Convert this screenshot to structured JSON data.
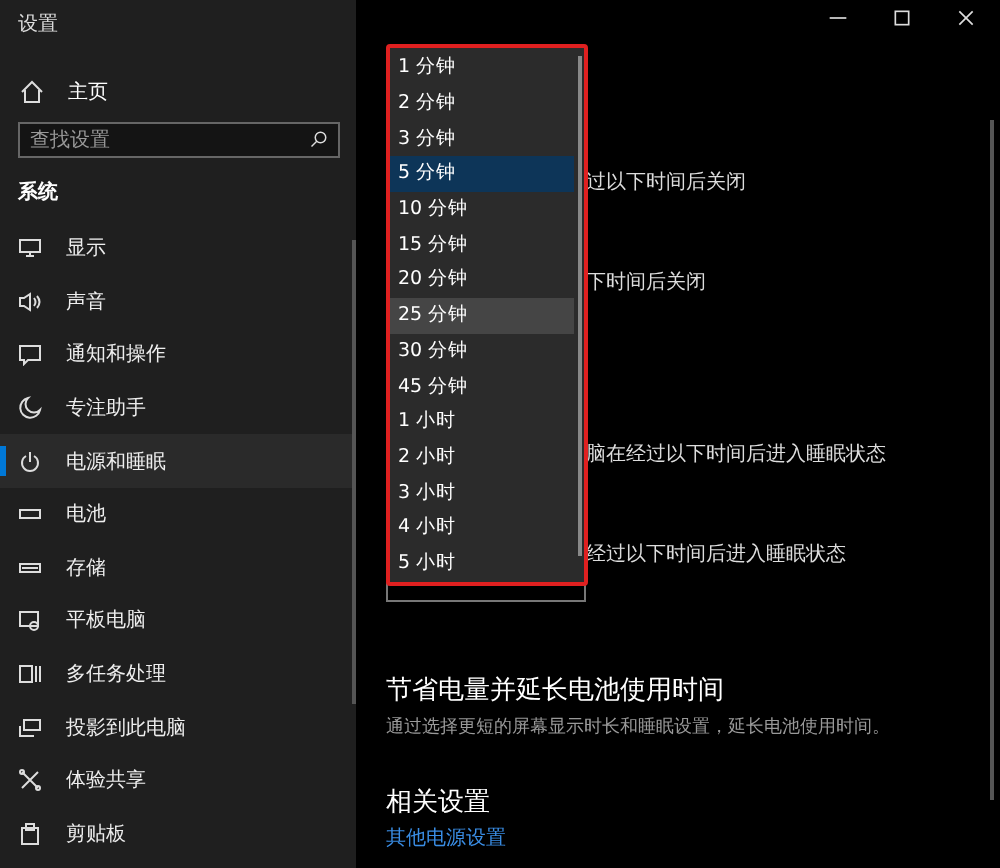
{
  "window": {
    "title": "设置"
  },
  "sidebar": {
    "home": "主页",
    "search": {
      "placeholder": "查找设置"
    },
    "section": "系统",
    "items": [
      {
        "label": "显示",
        "selected": false
      },
      {
        "label": "声音",
        "selected": false
      },
      {
        "label": "通知和操作",
        "selected": false
      },
      {
        "label": "专注助手",
        "selected": false
      },
      {
        "label": "电源和睡眠",
        "selected": true
      },
      {
        "label": "电池",
        "selected": false
      },
      {
        "label": "存储",
        "selected": false
      },
      {
        "label": "平板电脑",
        "selected": false
      },
      {
        "label": "多任务处理",
        "selected": false
      },
      {
        "label": "投影到此电脑",
        "selected": false
      },
      {
        "label": "体验共享",
        "selected": false
      },
      {
        "label": "剪贴板",
        "selected": false
      }
    ]
  },
  "content": {
    "setting_texts": [
      "过以下时间后关闭",
      "下时间后关闭",
      "脑在经过以下时间后进入睡眠状态",
      "经过以下时间后进入睡眠状态"
    ],
    "section_title": "节省电量并延长电池使用时间",
    "section_description": "通过选择更短的屏幕显示时长和睡眠设置，延长电池使用时间。",
    "related_title": "相关设置",
    "related_link": "其他电源设置"
  },
  "dropdown": {
    "options": [
      {
        "label": "1 分钟",
        "selected": false,
        "hovered": false
      },
      {
        "label": "2 分钟",
        "selected": false,
        "hovered": false
      },
      {
        "label": "3 分钟",
        "selected": false,
        "hovered": false
      },
      {
        "label": "5 分钟",
        "selected": true,
        "hovered": false
      },
      {
        "label": "10 分钟",
        "selected": false,
        "hovered": false
      },
      {
        "label": "15 分钟",
        "selected": false,
        "hovered": false
      },
      {
        "label": "20 分钟",
        "selected": false,
        "hovered": false
      },
      {
        "label": "25 分钟",
        "selected": false,
        "hovered": true
      },
      {
        "label": "30 分钟",
        "selected": false,
        "hovered": false
      },
      {
        "label": "45 分钟",
        "selected": false,
        "hovered": false
      },
      {
        "label": "1 小时",
        "selected": false,
        "hovered": false
      },
      {
        "label": "2 小时",
        "selected": false,
        "hovered": false
      },
      {
        "label": "3 小时",
        "selected": false,
        "hovered": false
      },
      {
        "label": "4 小时",
        "selected": false,
        "hovered": false
      },
      {
        "label": "5 小时",
        "selected": false,
        "hovered": false
      }
    ]
  }
}
